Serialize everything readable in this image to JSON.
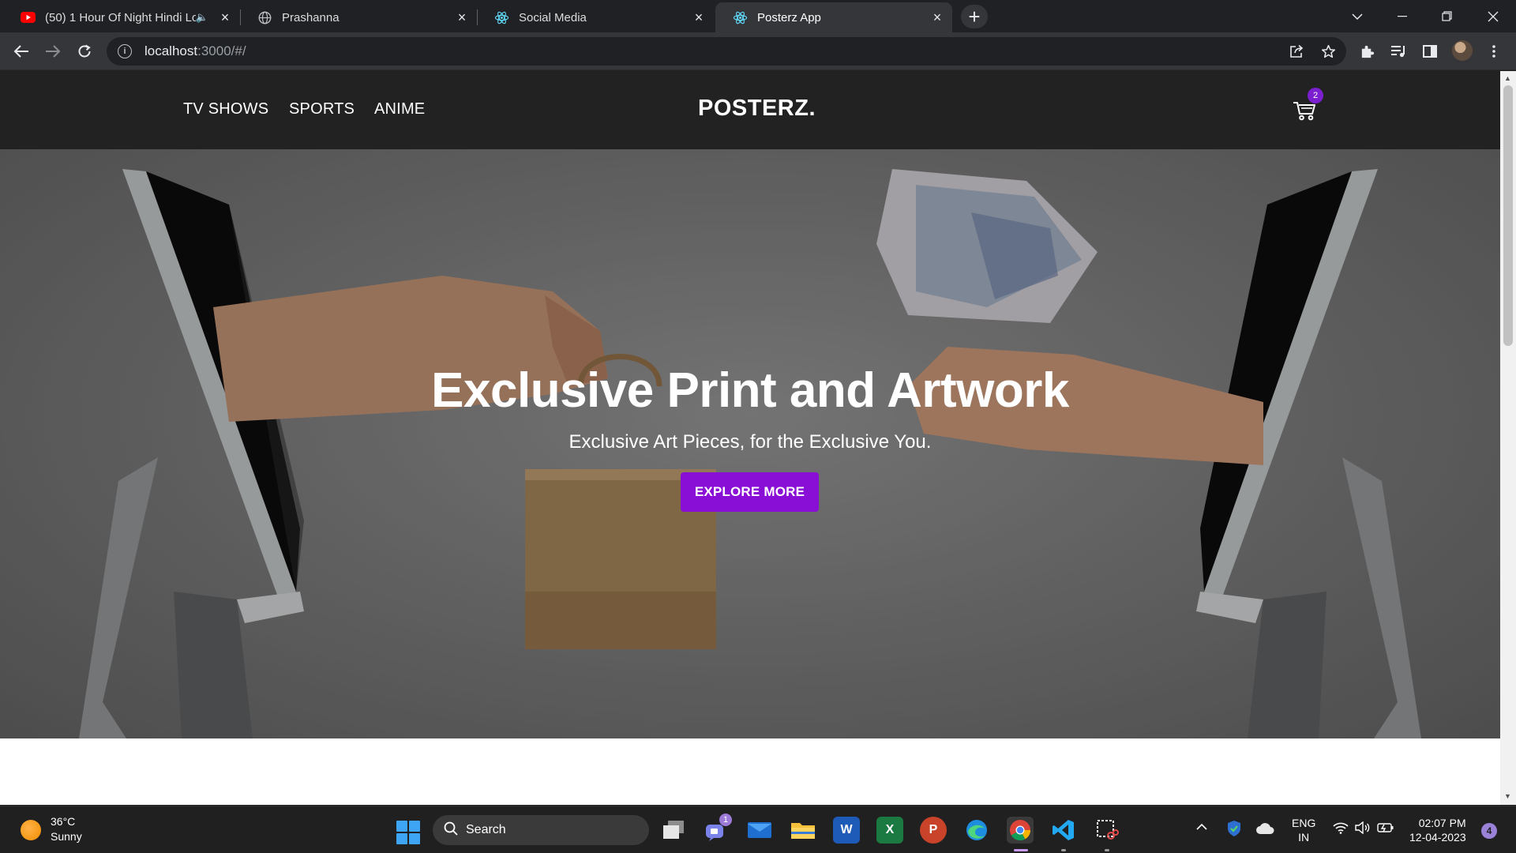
{
  "browser": {
    "tabs": [
      {
        "title": "(50) 1 Hour Of Night Hindi Lo",
        "icon": "youtube-icon",
        "audio": true,
        "active": false
      },
      {
        "title": "Prashanna",
        "icon": "globe-icon",
        "audio": false,
        "active": false
      },
      {
        "title": "Social Media",
        "icon": "react-icon",
        "audio": false,
        "active": false
      },
      {
        "title": "Posterz App",
        "icon": "react-icon",
        "audio": false,
        "active": true
      }
    ],
    "url_host": "localhost",
    "url_rest": ":3000/#/"
  },
  "site": {
    "nav_links": [
      "TV SHOWS",
      "SPORTS",
      "ANIME"
    ],
    "logo": "POSTERZ.",
    "cart_count": "2",
    "hero": {
      "title": "Exclusive Print and Artwork",
      "subtitle": "Exclusive Art Pieces, for the Exclusive You.",
      "cta": "EXPLORE MORE"
    },
    "colors": {
      "nav_bg": "#222222",
      "accent": "#8a0fd6",
      "badge": "#7b1fd1"
    }
  },
  "taskbar": {
    "weather": {
      "temp": "36°C",
      "desc": "Sunny"
    },
    "search_label": "Search",
    "teams_badge": "1",
    "lang": [
      "ENG",
      "IN"
    ],
    "time": "02:07 PM",
    "date": "12-04-2023",
    "notifications": "4"
  }
}
